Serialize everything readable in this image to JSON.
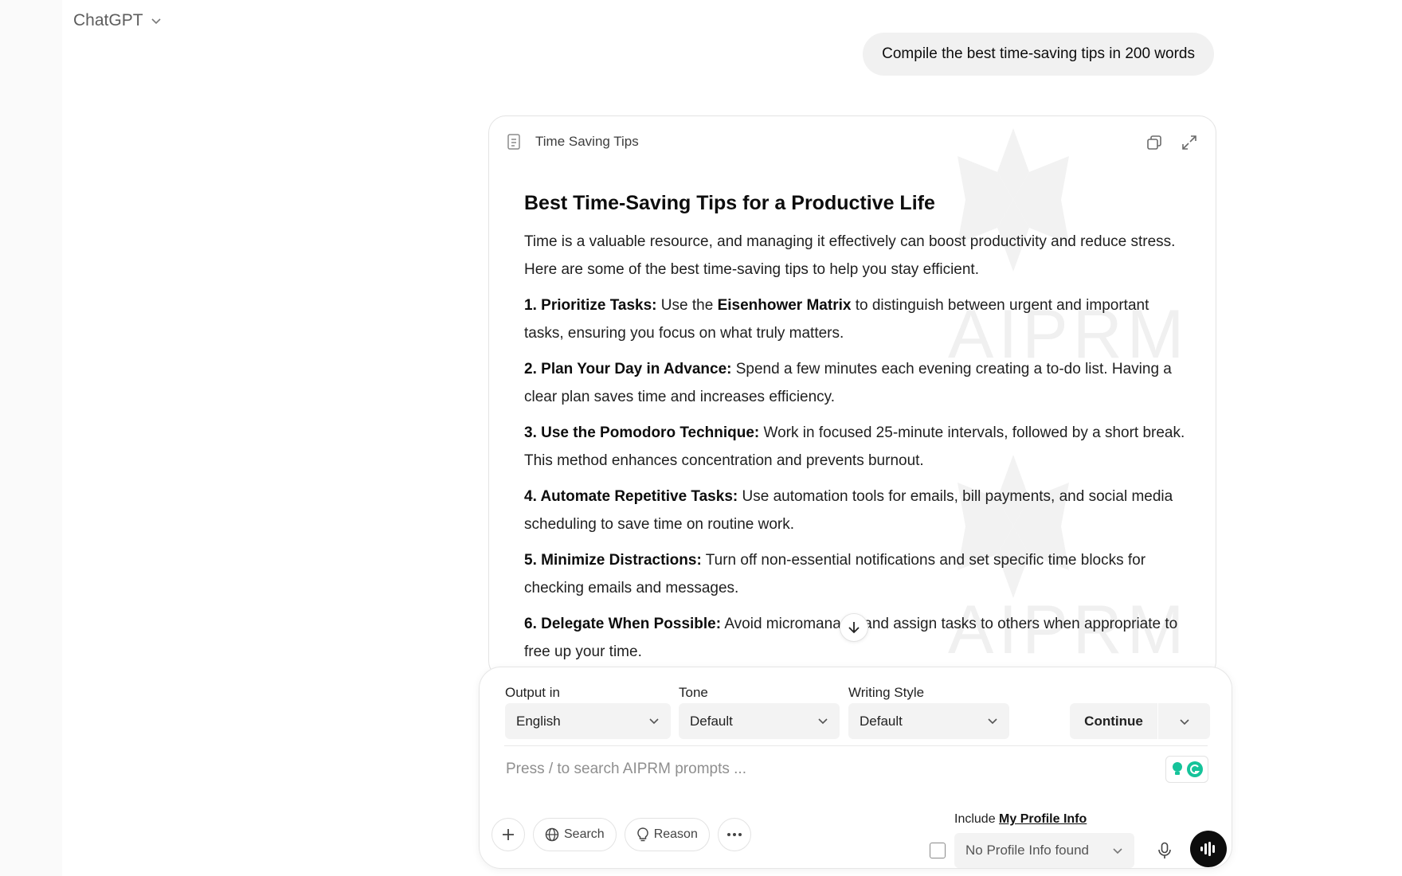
{
  "app": {
    "model_name": "ChatGPT"
  },
  "user_message": "Compile the best time-saving tips in 200 words",
  "canvas": {
    "title": "Time Saving Tips",
    "heading": "Best Time-Saving Tips for a Productive Life",
    "intro": "Time is a valuable resource, and managing it effectively can boost productivity and reduce stress. Here are some of the best time-saving tips to help you stay efficient.",
    "watermark": "AIPRM",
    "tips": [
      {
        "num": "1.",
        "title": "Prioritize Tasks:",
        "pre": " Use the ",
        "bold": "Eisenhower Matrix",
        "text": " to distinguish between urgent and important tasks, ensuring you focus on what truly matters."
      },
      {
        "num": "2.",
        "title": "Plan Your Day in Advance:",
        "pre": "",
        "bold": "",
        "text": " Spend a few minutes each evening creating a to-do list. Having a clear plan saves time and increases efficiency."
      },
      {
        "num": "3.",
        "title": "Use the Pomodoro Technique:",
        "pre": "",
        "bold": "",
        "text": " Work in focused 25-minute intervals, followed by a short break. This method enhances concentration and prevents burnout."
      },
      {
        "num": "4.",
        "title": "Automate Repetitive Tasks:",
        "pre": "",
        "bold": "",
        "text": " Use automation tools for emails, bill payments, and social media scheduling to save time on routine work."
      },
      {
        "num": "5.",
        "title": "Minimize Distractions:",
        "pre": "",
        "bold": "",
        "text": " Turn off non-essential notifications and set specific time blocks for checking emails and messages."
      },
      {
        "num": "6.",
        "title": "Delegate When Possible:",
        "pre": "",
        "bold": "",
        "text": " Avoid micromanaˎˎg and assign tasks to others when appropriate to free up your time."
      }
    ]
  },
  "composer": {
    "output_label": "Output in",
    "output_value": "English",
    "tone_label": "Tone",
    "tone_value": "Default",
    "style_label": "Writing Style",
    "style_value": "Default",
    "continue_label": "Continue",
    "prompt_placeholder": "Press / to search AIPRM prompts ...",
    "search_label": "Search",
    "reason_label": "Reason",
    "include_prefix": "Include ",
    "include_link": "My Profile Info",
    "profile_value": "No Profile Info found"
  },
  "icons": {
    "model_chevron": "chevron-down-icon",
    "doc": "document-icon",
    "copy": "copy-icon",
    "expand": "expand-icon",
    "scroll_down": "arrow-down-icon",
    "plus": "plus-icon",
    "globe": "globe-icon",
    "bulb": "lightbulb-icon",
    "more": "more-icon",
    "mic": "microphone-icon",
    "voice": "voice-mode-icon",
    "grammarly": "grammarly-icon"
  },
  "colors": {
    "accent": "#0d0d0d",
    "bubble": "#f1f1f1",
    "select_bg": "#f3f3f3",
    "grammarly": "#15c39a"
  }
}
